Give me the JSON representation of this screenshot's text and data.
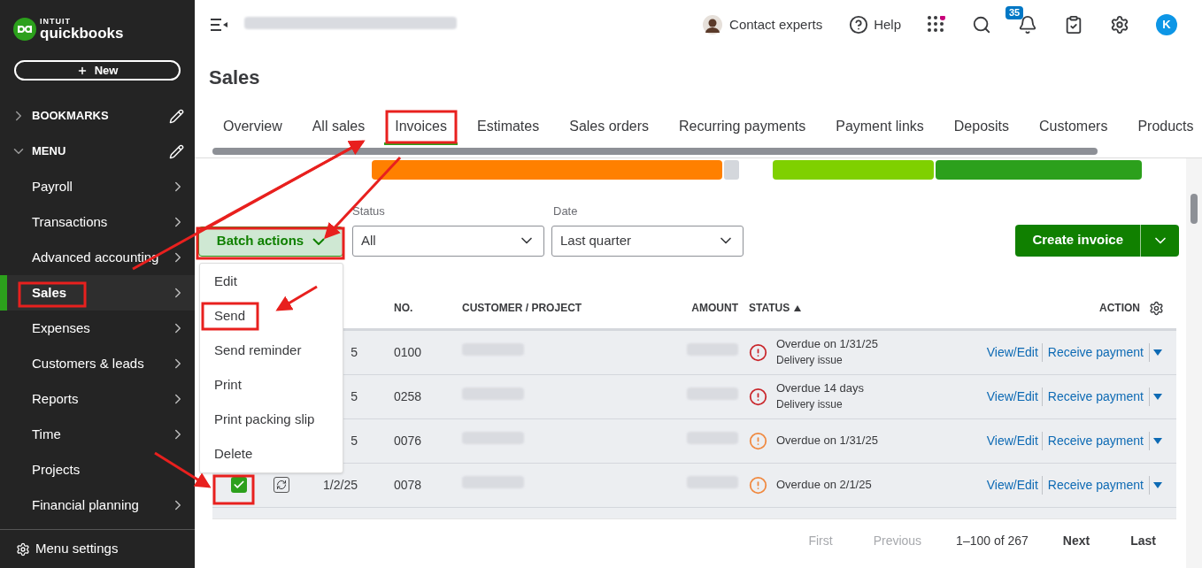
{
  "sidebar": {
    "logo": {
      "brand": "INTUIT",
      "product": "quickbooks"
    },
    "new_button": "New",
    "sections": [
      {
        "label": "BOOKMARKS",
        "expanded": false
      },
      {
        "label": "MENU",
        "expanded": true
      }
    ],
    "items": [
      {
        "label": "Payroll",
        "selected": false,
        "submenu": true
      },
      {
        "label": "Transactions",
        "selected": false,
        "submenu": true
      },
      {
        "label": "Advanced accounting",
        "selected": false,
        "submenu": true
      },
      {
        "label": "Sales",
        "selected": true,
        "submenu": true
      },
      {
        "label": "Expenses",
        "selected": false,
        "submenu": true
      },
      {
        "label": "Customers & leads",
        "selected": false,
        "submenu": true
      },
      {
        "label": "Reports",
        "selected": false,
        "submenu": true
      },
      {
        "label": "Time",
        "selected": false,
        "submenu": true
      },
      {
        "label": "Projects",
        "selected": false,
        "submenu": false
      },
      {
        "label": "Financial planning",
        "selected": false,
        "submenu": true
      }
    ],
    "footer": "Menu settings"
  },
  "topbar": {
    "contact": "Contact experts",
    "help": "Help",
    "notifications": "35",
    "avatar": "K"
  },
  "page_title": "Sales",
  "tabs": [
    {
      "label": "Overview",
      "selected": false
    },
    {
      "label": "All sales",
      "selected": false
    },
    {
      "label": "Invoices",
      "selected": true
    },
    {
      "label": "Estimates",
      "selected": false
    },
    {
      "label": "Sales orders",
      "selected": false
    },
    {
      "label": "Recurring payments",
      "selected": false
    },
    {
      "label": "Payment links",
      "selected": false
    },
    {
      "label": "Deposits",
      "selected": false
    },
    {
      "label": "Customers",
      "selected": false
    },
    {
      "label": "Products",
      "selected": false
    }
  ],
  "filters": {
    "batch_actions": "Batch actions",
    "status": {
      "label": "Status",
      "value": "All"
    },
    "date": {
      "label": "Date",
      "value": "Last quarter"
    },
    "create_button": "Create invoice"
  },
  "batch_menu": [
    "Edit",
    "Send",
    "Send reminder",
    "Print",
    "Print packing slip",
    "Delete"
  ],
  "table": {
    "columns": [
      "NO.",
      "CUSTOMER / PROJECT",
      "AMOUNT",
      "STATUS",
      "ACTION"
    ],
    "rows": [
      {
        "date": "5",
        "no": "0100",
        "status": "Overdue on 1/31/25",
        "detail": "Delivery issue",
        "color": "#c9252a",
        "actions": [
          "View/Edit",
          "Receive payment"
        ]
      },
      {
        "date": "5",
        "no": "0258",
        "status": "Overdue 14 days",
        "detail": "Delivery issue",
        "color": "#c9252a",
        "actions": [
          "View/Edit",
          "Receive payment"
        ]
      },
      {
        "date": "5",
        "no": "0076",
        "status": "Overdue on 1/31/25",
        "color": "#f0883e",
        "actions": [
          "View/Edit",
          "Receive payment"
        ]
      },
      {
        "date": "1/2/25",
        "no": "0078",
        "status": "Overdue on 2/1/25",
        "color": "#f0883e",
        "checked": true,
        "recurring": true,
        "actions": [
          "View/Edit",
          "Receive payment"
        ]
      }
    ]
  },
  "pagination": [
    {
      "label": "First",
      "disabled": true
    },
    {
      "label": "Previous",
      "disabled": true
    },
    {
      "label": "1–100 of 267",
      "kind": "range"
    },
    {
      "label": "Next",
      "disabled": false
    },
    {
      "label": "Last",
      "disabled": false
    }
  ]
}
